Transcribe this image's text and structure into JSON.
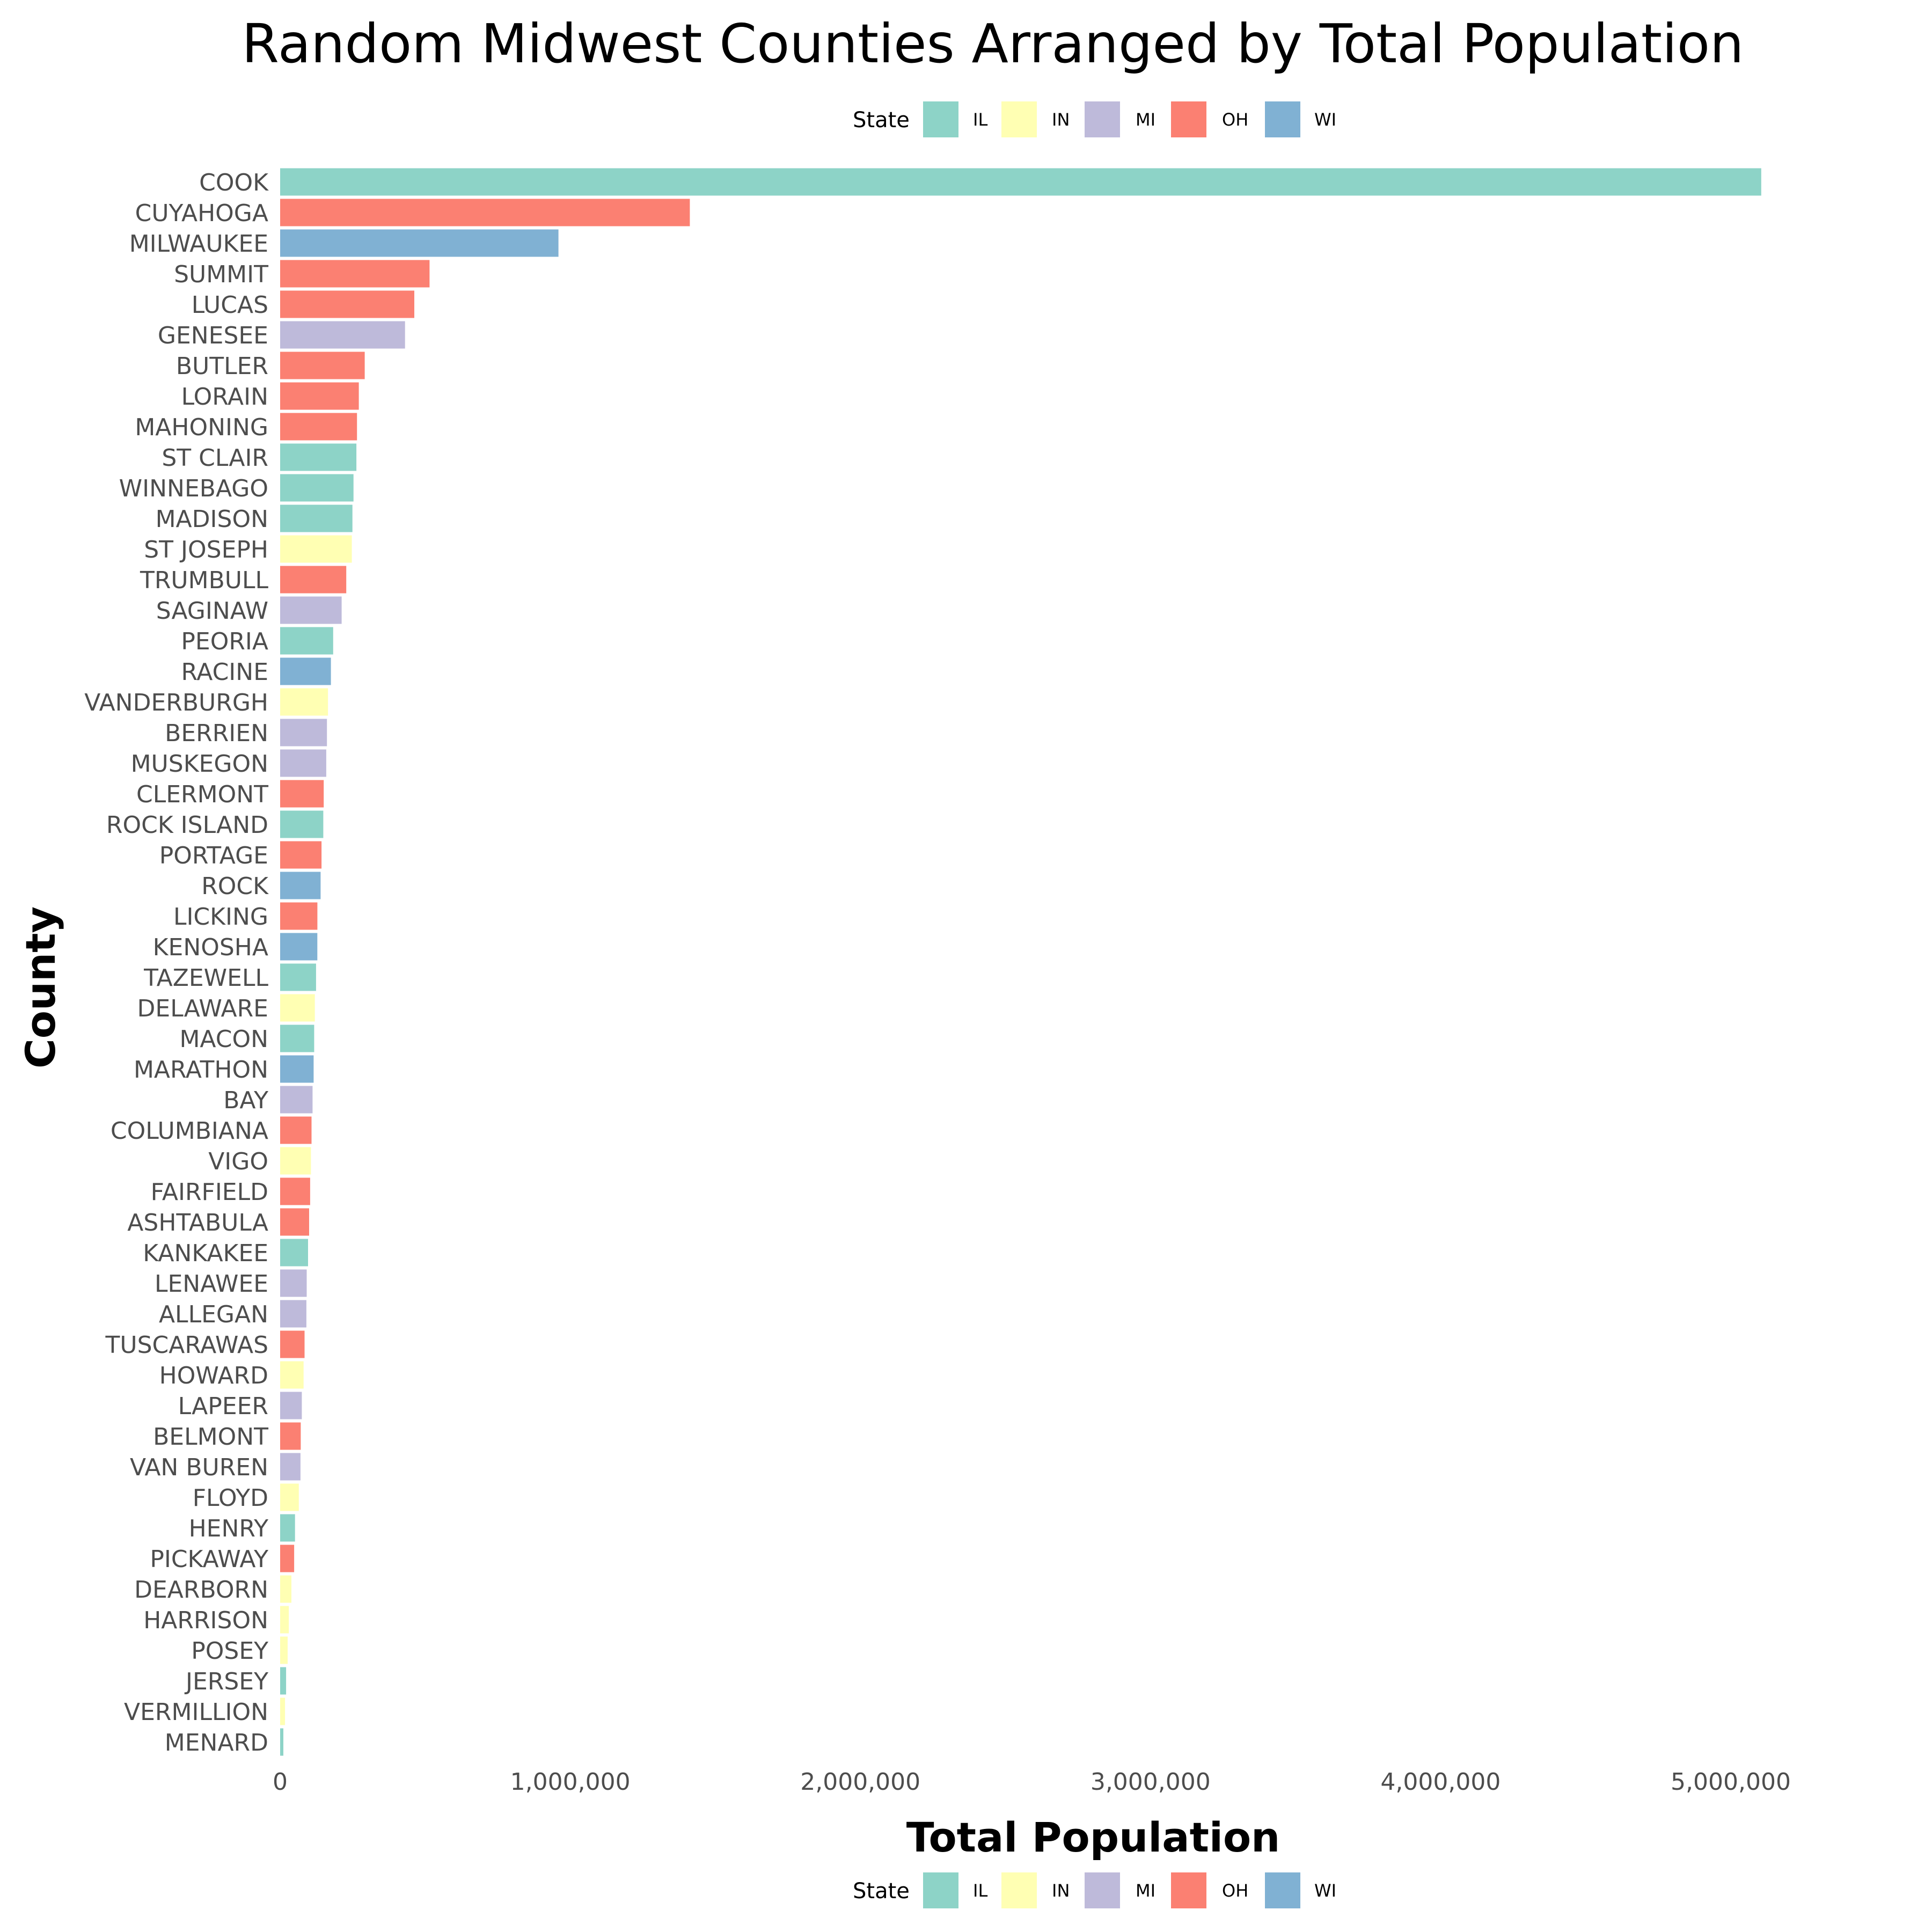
{
  "chart_data": {
    "type": "bar",
    "orientation": "horizontal",
    "title": "Random Midwest Counties Arranged by Total Population",
    "xlabel": "Total Population",
    "ylabel": "County",
    "xlim": [
      0,
      5600000
    ],
    "x_ticks": [
      0,
      1000000,
      2000000,
      3000000,
      4000000,
      5000000
    ],
    "x_tick_labels": [
      "0",
      "1,000,000",
      "2,000,000",
      "3,000,000",
      "4,000,000",
      "5,000,000"
    ],
    "grid": false,
    "legend": {
      "title": "State",
      "placement": [
        "top",
        "bottom"
      ],
      "entries": [
        {
          "label": "IL",
          "color": "#8dd3c7"
        },
        {
          "label": "IN",
          "color": "#ffffb3"
        },
        {
          "label": "MI",
          "color": "#bebada"
        },
        {
          "label": "OH",
          "color": "#fb8072"
        },
        {
          "label": "WI",
          "color": "#80b1d3"
        }
      ]
    },
    "categories": [
      "COOK",
      "CUYAHOGA",
      "MILWAUKEE",
      "SUMMIT",
      "LUCAS",
      "GENESEE",
      "BUTLER",
      "LORAIN",
      "MAHONING",
      "ST CLAIR",
      "WINNEBAGO",
      "MADISON",
      "ST JOSEPH",
      "TRUMBULL",
      "SAGINAW",
      "PEORIA",
      "RACINE",
      "VANDERBURGH",
      "BERRIEN",
      "MUSKEGON",
      "CLERMONT",
      "ROCK ISLAND",
      "PORTAGE",
      "ROCK",
      "LICKING",
      "KENOSHA",
      "TAZEWELL",
      "DELAWARE",
      "MACON",
      "MARATHON",
      "BAY",
      "COLUMBIANA",
      "VIGO",
      "FAIRFIELD",
      "ASHTABULA",
      "KANKAKEE",
      "LENAWEE",
      "ALLEGAN",
      "TUSCARAWAS",
      "HOWARD",
      "LAPEER",
      "BELMONT",
      "VAN BUREN",
      "FLOYD",
      "HENRY",
      "PICKAWAY",
      "DEARBORN",
      "HARRISON",
      "POSEY",
      "JERSEY",
      "VERMILLION",
      "MENARD"
    ],
    "states": [
      "IL",
      "OH",
      "WI",
      "OH",
      "OH",
      "MI",
      "OH",
      "OH",
      "OH",
      "IL",
      "IL",
      "IL",
      "IN",
      "OH",
      "MI",
      "IL",
      "WI",
      "IN",
      "MI",
      "MI",
      "OH",
      "IL",
      "OH",
      "WI",
      "OH",
      "WI",
      "IL",
      "IN",
      "IL",
      "WI",
      "MI",
      "OH",
      "IN",
      "OH",
      "OH",
      "IL",
      "MI",
      "MI",
      "OH",
      "IN",
      "MI",
      "OH",
      "MI",
      "IN",
      "IL",
      "OH",
      "IN",
      "IN",
      "IN",
      "IL",
      "IN",
      "IL"
    ],
    "values": [
      5105067,
      1412140,
      959275,
      514990,
      462361,
      430459,
      291479,
      271126,
      264806,
      262852,
      252913,
      249238,
      247052,
      227813,
      211946,
      182827,
      175034,
      165058,
      161378,
      158983,
      150187,
      148723,
      142585,
      139510,
      128300,
      128181,
      123692,
      119659,
      117206,
      115400,
      111723,
      108276,
      106107,
      103461,
      99821,
      96255,
      91476,
      90509,
      84090,
      80827,
      74768,
      71074,
      70060,
      64404,
      51159,
      48255,
      38835,
      29890,
      25968,
      20539,
      16773,
      11164
    ]
  }
}
